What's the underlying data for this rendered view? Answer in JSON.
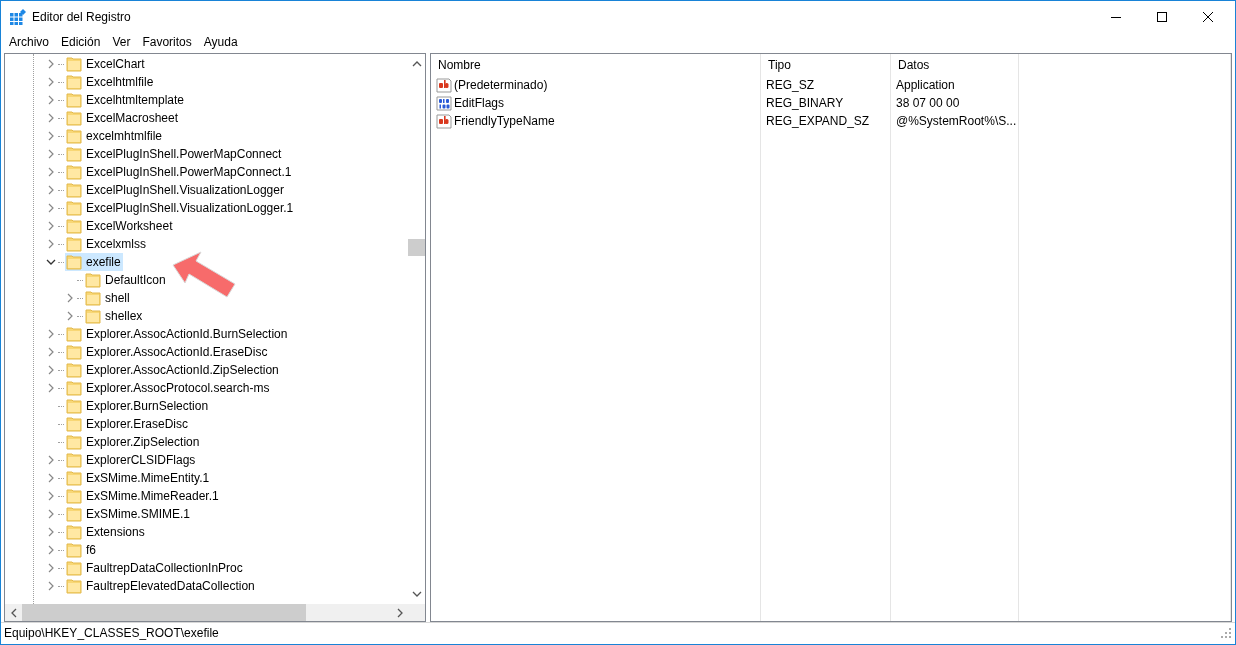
{
  "window": {
    "title": "Editor del Registro"
  },
  "menu": [
    "Archivo",
    "Edición",
    "Ver",
    "Favoritos",
    "Ayuda"
  ],
  "tree": [
    {
      "label": "ExcelChart",
      "expanded": false,
      "selected": false
    },
    {
      "label": "Excelhtmlfile",
      "expanded": false,
      "selected": false
    },
    {
      "label": "Excelhtmltemplate",
      "expanded": false,
      "selected": false
    },
    {
      "label": "ExcelMacrosheet",
      "expanded": false,
      "selected": false
    },
    {
      "label": "excelmhtmlfile",
      "expanded": false,
      "selected": false
    },
    {
      "label": "ExcelPlugInShell.PowerMapConnect",
      "expanded": false,
      "selected": false
    },
    {
      "label": "ExcelPlugInShell.PowerMapConnect.1",
      "expanded": false,
      "selected": false
    },
    {
      "label": "ExcelPlugInShell.VisualizationLogger",
      "expanded": false,
      "selected": false
    },
    {
      "label": "ExcelPlugInShell.VisualizationLogger.1",
      "expanded": false,
      "selected": false
    },
    {
      "label": "ExcelWorksheet",
      "expanded": false,
      "selected": false
    },
    {
      "label": "Excelxmlss",
      "expanded": false,
      "selected": false
    },
    {
      "label": "exefile",
      "expanded": true,
      "selected": true,
      "children": [
        {
          "label": "DefaultIcon",
          "selected": false
        },
        {
          "label": "shell",
          "expanded": false,
          "selected": false
        },
        {
          "label": "shellex",
          "expanded": false,
          "selected": false
        }
      ]
    },
    {
      "label": "Explorer.AssocActionId.BurnSelection",
      "expanded": false,
      "selected": false
    },
    {
      "label": "Explorer.AssocActionId.EraseDisc",
      "expanded": false,
      "selected": false
    },
    {
      "label": "Explorer.AssocActionId.ZipSelection",
      "expanded": false,
      "selected": false
    },
    {
      "label": "Explorer.AssocProtocol.search-ms",
      "expanded": false,
      "selected": false
    },
    {
      "label": "Explorer.BurnSelection",
      "selected": false
    },
    {
      "label": "Explorer.EraseDisc",
      "selected": false
    },
    {
      "label": "Explorer.ZipSelection",
      "selected": false
    },
    {
      "label": "ExplorerCLSIDFlags",
      "expanded": false,
      "selected": false
    },
    {
      "label": "ExSMime.MimeEntity.1",
      "expanded": false,
      "selected": false
    },
    {
      "label": "ExSMime.MimeReader.1",
      "expanded": false,
      "selected": false
    },
    {
      "label": "ExSMime.SMIME.1",
      "expanded": false,
      "selected": false
    },
    {
      "label": "Extensions",
      "expanded": false,
      "selected": false
    },
    {
      "label": "f6",
      "expanded": false,
      "selected": false
    },
    {
      "label": "FaultrepDataCollectionInProc",
      "expanded": false,
      "selected": false
    },
    {
      "label": "FaultrepElevatedDataCollection",
      "expanded": false,
      "selected": false
    }
  ],
  "values": {
    "columns": [
      "Nombre",
      "Tipo",
      "Datos"
    ],
    "rows": [
      {
        "kind": "string",
        "name": "(Predeterminado)",
        "type": "REG_SZ",
        "data": "Application"
      },
      {
        "kind": "binary",
        "name": "EditFlags",
        "type": "REG_BINARY",
        "data": "38 07 00 00"
      },
      {
        "kind": "string",
        "name": "FriendlyTypeName",
        "type": "REG_EXPAND_SZ",
        "data": "@%SystemRoot%\\S..."
      }
    ]
  },
  "status_bar": "Equipo\\HKEY_CLASSES_ROOT\\exefile"
}
